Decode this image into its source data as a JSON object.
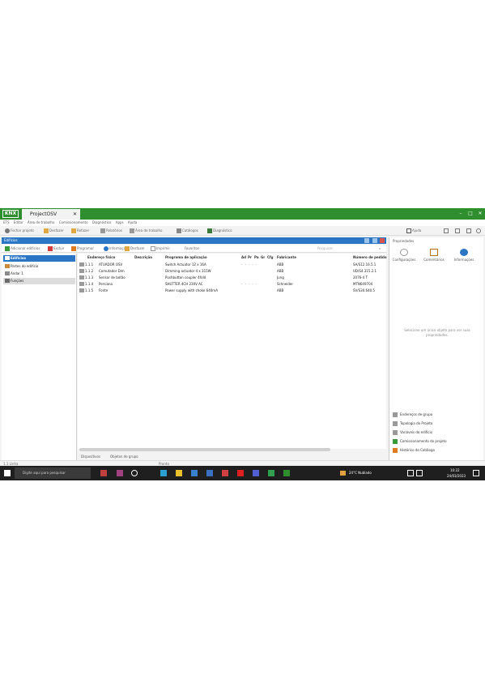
{
  "window": {
    "logo": "KNX",
    "tab_title": "ProjectOSV",
    "tab_close": "✕",
    "minimize": "–",
    "maximize": "□",
    "close": "✕"
  },
  "menubar": {
    "items": [
      "ETS",
      "Editar",
      "Área de trabalho",
      "Comissionamento",
      "Diagnóstico",
      "Apps",
      "Ajuda"
    ]
  },
  "toolbar": {
    "items": [
      "Fechar projeto",
      "Desfazer",
      "Refazer",
      "Relatórios",
      "Área de trabalho",
      "Catálogos",
      "Diagnóstico"
    ],
    "right_items": [
      "Ajuda",
      "Minimizar",
      "Restaurar"
    ]
  },
  "panel": {
    "title": "Edifícios",
    "subtool": [
      "Adicionar edifícios",
      "Excluir",
      "Programar",
      "Informações",
      "Desfazer",
      "Imprimir",
      "Favoritos"
    ],
    "search_placeholder": "Pesquisar"
  },
  "tree": {
    "items": [
      {
        "label": "Edifícios",
        "selected": false,
        "head": true
      },
      {
        "label": "Partes do edifício",
        "selected": false
      },
      {
        "label": "Andar 1",
        "selected": false
      },
      {
        "label": "Funções",
        "selected": true
      }
    ]
  },
  "grid": {
    "columns": [
      "Endereço físico",
      "Descrição",
      "Programa de aplicação",
      "Ad",
      "Pr",
      "Pa",
      "Gr",
      "Cfg",
      "Fabricante",
      "Número de pedido"
    ],
    "rows": [
      {
        "addr": "1.1.1",
        "name": "ATUADOR OSV",
        "desc": "",
        "app": "Switch Actuator 12 x 16A",
        "mfr": "ABB",
        "order": "SA/S12.16.5.1"
      },
      {
        "addr": "1.1.2",
        "name": "Comutador Dim",
        "desc": "",
        "app": "Dimming actuator 4 x 315W",
        "mfr": "ABB",
        "order": "UD/S4.315.2.1"
      },
      {
        "addr": "1.1.3",
        "name": "Sensor de botão",
        "desc": "",
        "app": "Pushbutton coupler 4fold",
        "mfr": "Jung",
        "order": "2076-4 T"
      },
      {
        "addr": "1.1.4",
        "name": "Persiana",
        "desc": "",
        "app": "SHUTTER 4CH 230V AC",
        "mfr": "Schneider",
        "order": "MTN649704"
      },
      {
        "addr": "1.1.5",
        "name": "Fonte",
        "desc": "",
        "app": "Power supply with choke 640mA",
        "mfr": "ABB",
        "order": "SV/S30.640.5"
      }
    ]
  },
  "bottom_tabs": [
    "Dispositivos",
    "Objetos de grupo"
  ],
  "status": {
    "left": "1.1 Linha",
    "middle": "Pronto"
  },
  "side": {
    "title": "Propriedades",
    "buttons": [
      "Configurações",
      "Comentários",
      "Informações"
    ],
    "message": "Selecione um único objeto para ver suas propriedades.",
    "links": [
      "Endereços de grupo",
      "Topologia do Projeto",
      "Variáveis do edifício",
      "Comissionamento do projeto",
      "Histórico do Catálogo"
    ]
  },
  "taskbar": {
    "search_placeholder": "Digite aqui para pesquisar",
    "weather": "24°C  Nublado",
    "time": "10:22",
    "date": "24/03/2023"
  },
  "colors": {
    "title_green": "#2f8f2f",
    "accent_blue": "#2a76c5",
    "taskbar": "#1f1f1f"
  }
}
